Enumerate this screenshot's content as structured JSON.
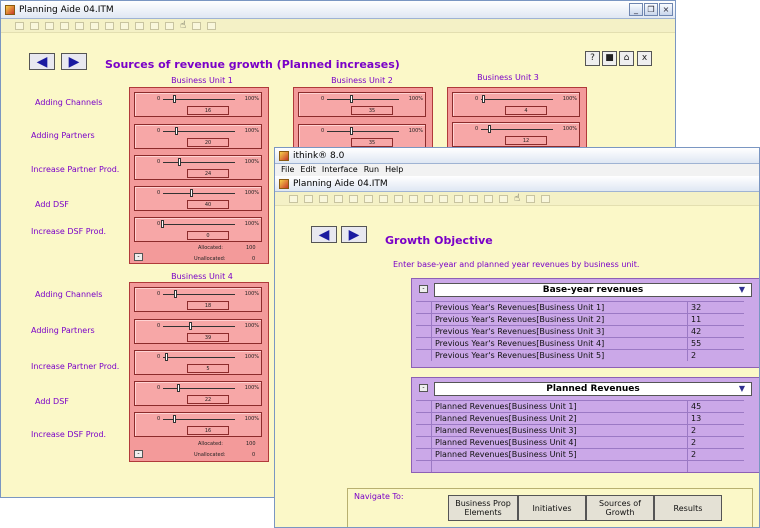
{
  "back_window": {
    "title": "Planning Aide 04.ITM",
    "heading": "Sources of revenue growth (Planned increases)",
    "units": [
      {
        "name": "Business Unit 1"
      },
      {
        "name": "Business Unit 2"
      },
      {
        "name": "Business Unit 3"
      },
      {
        "name": "Business Unit 4"
      }
    ],
    "row_labels": [
      "Adding Channels",
      "Adding Partners",
      "Increase Partner Prod.",
      "Add DSF",
      "Increase DSF Prod."
    ],
    "slider_min": "0",
    "slider_max": "100%",
    "unit1_values": [
      "16",
      "20",
      "24",
      "40",
      "0"
    ],
    "unit1_fractions": [
      0.16,
      0.2,
      0.24,
      0.4,
      0.0
    ],
    "unit2_values": [
      "35",
      "35"
    ],
    "unit2_fractions": [
      0.35,
      0.35
    ],
    "unit3_values": [
      "4",
      "12"
    ],
    "unit3_fractions": [
      0.04,
      0.12
    ],
    "unit4_values": [
      "18",
      "39",
      "5",
      "22",
      "16"
    ],
    "unit4_fractions": [
      0.18,
      0.39,
      0.05,
      0.22,
      0.16
    ],
    "allocated_label": "Allocated:",
    "unallocated_label": "Unallocated:",
    "unit1_allocated": "100",
    "unit1_unallocated": "0",
    "unit4_allocated": "100",
    "unit4_unallocated": "0",
    "buttons": [
      "?",
      "■",
      "⌂",
      "x"
    ]
  },
  "front_window": {
    "app_title": "ithink® 8.0",
    "menu": [
      "File",
      "Edit",
      "Interface",
      "Run",
      "Help"
    ],
    "doc_title": "Planning Aide 04.ITM",
    "heading": "Growth Objective",
    "instruction": "Enter base-year and planned year revenues by business unit.",
    "table1": {
      "header": "Base-year revenues",
      "rows": [
        {
          "label": "Previous Year's Revenues[Business Unit 1]",
          "value": "32"
        },
        {
          "label": "Previous Year's Revenues[Business Unit 2]",
          "value": "11"
        },
        {
          "label": "Previous Year's Revenues[Business Unit 3]",
          "value": "42"
        },
        {
          "label": "Previous Year's Revenues[Business Unit 4]",
          "value": "55"
        },
        {
          "label": "Previous Year's Revenues[Business Unit 5]",
          "value": "2"
        }
      ]
    },
    "table2": {
      "header": "Planned Revenues",
      "rows": [
        {
          "label": "Planned Revenues[Business Unit 1]",
          "value": "45"
        },
        {
          "label": "Planned Revenues[Business Unit 2]",
          "value": "13"
        },
        {
          "label": "Planned Revenues[Business Unit 3]",
          "value": "2"
        },
        {
          "label": "Planned Revenues[Business Unit 4]",
          "value": "2"
        },
        {
          "label": "Planned Revenues[Business Unit 5]",
          "value": "2"
        }
      ]
    },
    "navigate_label": "Navigate To:",
    "nav_buttons": [
      "Business Prop Elements",
      "Initiatives",
      "Sources of Growth",
      "Results"
    ]
  }
}
